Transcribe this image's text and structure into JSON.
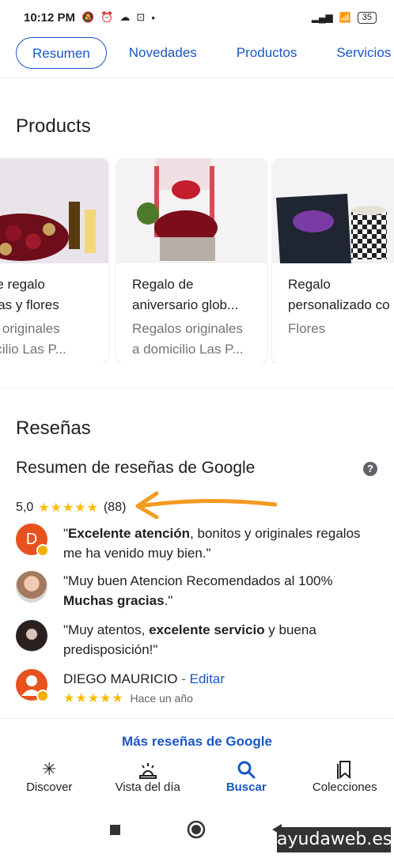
{
  "status_bar": {
    "time": "10:12 PM",
    "battery": "35"
  },
  "tabs": [
    {
      "label": "Resumen"
    },
    {
      "label": "Novedades"
    },
    {
      "label": "Productos"
    },
    {
      "label": "Servicios"
    }
  ],
  "products": {
    "title": "Products",
    "items": [
      {
        "title1": "ta de regalo",
        "title2": "Rosas y flores",
        "sub1": "alos originales",
        "sub2": "omicilio Las P..."
      },
      {
        "title1": "Regalo de",
        "title2": "aniversario glob...",
        "sub1": "Regalos originales",
        "sub2": "a domicilio Las P..."
      },
      {
        "title1": "Regalo",
        "title2": "personalizado co",
        "sub1": "Flores",
        "sub2": ""
      }
    ]
  },
  "reviews": {
    "title": "Reseñas",
    "summary_title": "Resumen de reseñas de Google",
    "rating": "5,0",
    "stars": "★★★★★",
    "count": "(88)",
    "items": [
      {
        "quote_open": "\"",
        "bold": "Excelente atención",
        "rest": ", bonitos y originales regalos me ha venido muy bien.\"",
        "avatar_letter": "D"
      },
      {
        "pre": "\"Muy buen Atencion Recomendados al 100% ",
        "bold": "Muchas gracias",
        "post": ".\""
      },
      {
        "pre": "\"Muy atentos, ",
        "bold": "excelente servicio",
        "post": " y buena predisposición!\""
      }
    ],
    "own": {
      "name": "DIEGO MAURICIO",
      "sep": " - ",
      "edit": "Editar",
      "stars": "★★★★★",
      "when": "Hace un año"
    },
    "more": "Más reseñas de Google"
  },
  "bottom_nav": [
    {
      "label": "Discover",
      "icon": "asterisk-icon"
    },
    {
      "label": "Vista del día",
      "icon": "sunrise-icon"
    },
    {
      "label": "Buscar",
      "icon": "search-icon"
    },
    {
      "label": "Colecciones",
      "icon": "bookmarks-icon"
    }
  ],
  "watermark": "ayudaweb.es",
  "colors": {
    "accent": "#1a56c4",
    "star": "#fbbc04",
    "arrow": "#f39a1f"
  }
}
